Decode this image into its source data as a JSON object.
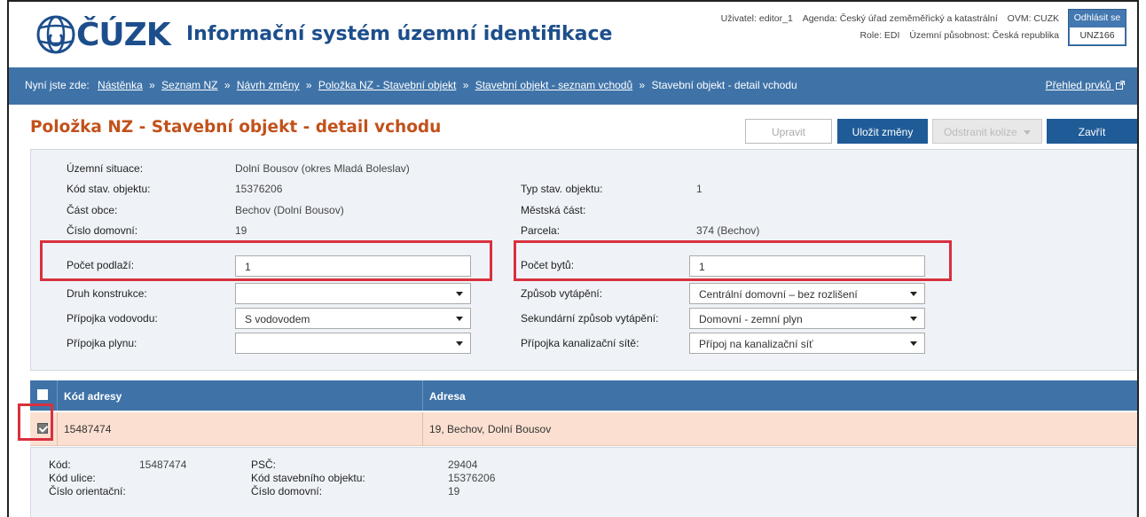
{
  "header": {
    "logo_text": "ČÚZK",
    "app_title": "Informační systém územní identifikace",
    "user_label": "Uživatel: editor_1",
    "agenda_label": "Agenda: Český úřad zeměměřický a katastrální",
    "ovm_label": "OVM: CUZK",
    "role_label": "Role: EDI",
    "scope_label": "Územní působnost: Česká republika",
    "logout_label": "Odhlásit se",
    "session_code": "UNZ166"
  },
  "breadcrumb": {
    "prefix": "Nyní jste zde:",
    "items": [
      "Nástěnka",
      "Seznam NZ",
      "Návrh změny",
      "Položka NZ - Stavební objekt",
      "Stavební objekt - seznam vchodů"
    ],
    "current": "Stavební objekt - detail vchodu",
    "separator": "»",
    "overview_link": "Přehled prvků"
  },
  "page": {
    "title": "Položka NZ - Stavební objekt - detail vchodu"
  },
  "toolbar": {
    "edit_label": "Upravit",
    "save_label": "Uložit změny",
    "remove_conflicts_label": "Odstranit kolize",
    "close_label": "Zavřít"
  },
  "detail": {
    "uzemni_situace_label": "Územní situace:",
    "uzemni_situace_value": "Dolní Bousov (okres Mladá Boleslav)",
    "kod_stav_objektu_label": "Kód stav. objektu:",
    "kod_stav_objektu_value": "15376206",
    "typ_stav_objektu_label": "Typ stav. objektu:",
    "typ_stav_objektu_value": "1",
    "cast_obce_label": "Část obce:",
    "cast_obce_value": "Bechov (Dolní Bousov)",
    "mestska_cast_label": "Městská část:",
    "mestska_cast_value": "",
    "cislo_domovni_label": "Číslo domovní:",
    "cislo_domovni_value": "19",
    "parcela_label": "Parcela:",
    "parcela_value": "374 (Bechov)",
    "pocet_podlazi_label": "Počet podlaží:",
    "pocet_podlazi_value": "1",
    "pocet_bytu_label": "Počet bytů:",
    "pocet_bytu_value": "1",
    "druh_konstrukce_label": "Druh konstrukce:",
    "druh_konstrukce_value": "",
    "zpusob_vytapeni_label": "Způsob vytápění:",
    "zpusob_vytapeni_value": "Centrální domovní – bez rozlišení",
    "pripojka_vodovodu_label": "Přípojka vodovodu:",
    "pripojka_vodovodu_value": "S vodovodem",
    "sekundarni_vytapeni_label": "Sekundární způsob vytápění:",
    "sekundarni_vytapeni_value": "Domovní - zemní plyn",
    "pripojka_plynu_label": "Přípojka plynu:",
    "pripojka_plynu_value": "",
    "pripojka_kanalizace_label": "Přípojka kanalizační sítě:",
    "pripojka_kanalizace_value": "Přípoj na kanalizační síť"
  },
  "table": {
    "headers": [
      "Kód adresy",
      "Adresa"
    ],
    "rows": [
      {
        "kod_adresy": "15487474",
        "adresa": "19, Bechov, Dolní Bousov",
        "checked": true
      }
    ]
  },
  "address_detail": {
    "kod_label": "Kód:",
    "kod_value": "15487474",
    "kod_ulice_label": "Kód ulice:",
    "kod_ulice_value": "",
    "cislo_orientacni_label": "Číslo orientační:",
    "cislo_orientacni_value": "",
    "psc_label": "PSČ:",
    "psc_value": "29404",
    "kod_stav_objektu_label": "Kód stavebního objektu:",
    "kod_stav_objektu_value": "15376206",
    "cislo_domovni_label": "Číslo domovní:",
    "cislo_domovni_value": "19"
  },
  "colors": {
    "brand_blue": "#1d4e8c",
    "bar_blue": "#3f73a8",
    "title_orange": "#c2511b",
    "highlight_red": "#d9303d",
    "selected_row": "#fbe0d1"
  },
  "icons": {
    "external_link": "external-link-icon",
    "dropdown_caret": "caret-down-icon",
    "logo": "cuzk-logo-icon"
  }
}
